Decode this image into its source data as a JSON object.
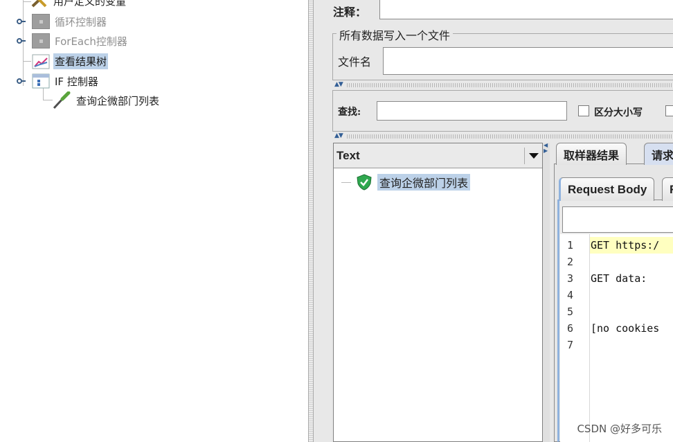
{
  "tree": {
    "items": [
      {
        "label": "用户定义的变量",
        "icon": "wrench-icon"
      },
      {
        "label": "循环控制器",
        "icon": "controller-icon"
      },
      {
        "label": "ForEach控制器",
        "icon": "controller-icon"
      },
      {
        "label": "查看结果树",
        "icon": "chart-icon"
      },
      {
        "label": "IF 控制器",
        "icon": "if-controller-icon"
      },
      {
        "label": "查询企微部门列表",
        "icon": "sampler-pipette-icon"
      }
    ]
  },
  "panel": {
    "comment_label": "注释：",
    "comment_value": "",
    "group_title": "所有数据写入一个文件",
    "filename_label": "文件名",
    "filename_value": "",
    "search_label": "查找:",
    "search_value": "",
    "case_sensitive_label": "区分大小写"
  },
  "results": {
    "renderer_selected": "Text",
    "items": [
      {
        "label": "查询企微部门列表",
        "status": "success"
      }
    ]
  },
  "tabs": {
    "outer": [
      "取样器结果",
      "请求"
    ],
    "inner": [
      "Request Body",
      "R"
    ]
  },
  "editor": {
    "line_numbers": [
      "1",
      "2",
      "3",
      "4",
      "5",
      "6",
      "7"
    ],
    "lines": [
      "GET https:/",
      "",
      "GET data:",
      "",
      "",
      "[no cookies",
      ""
    ]
  },
  "watermark": "CSDN @好多可乐",
  "colors": {
    "selection": "#bcd1e8",
    "success": "#2fa84f",
    "highlight_line": "#ffffc0"
  }
}
